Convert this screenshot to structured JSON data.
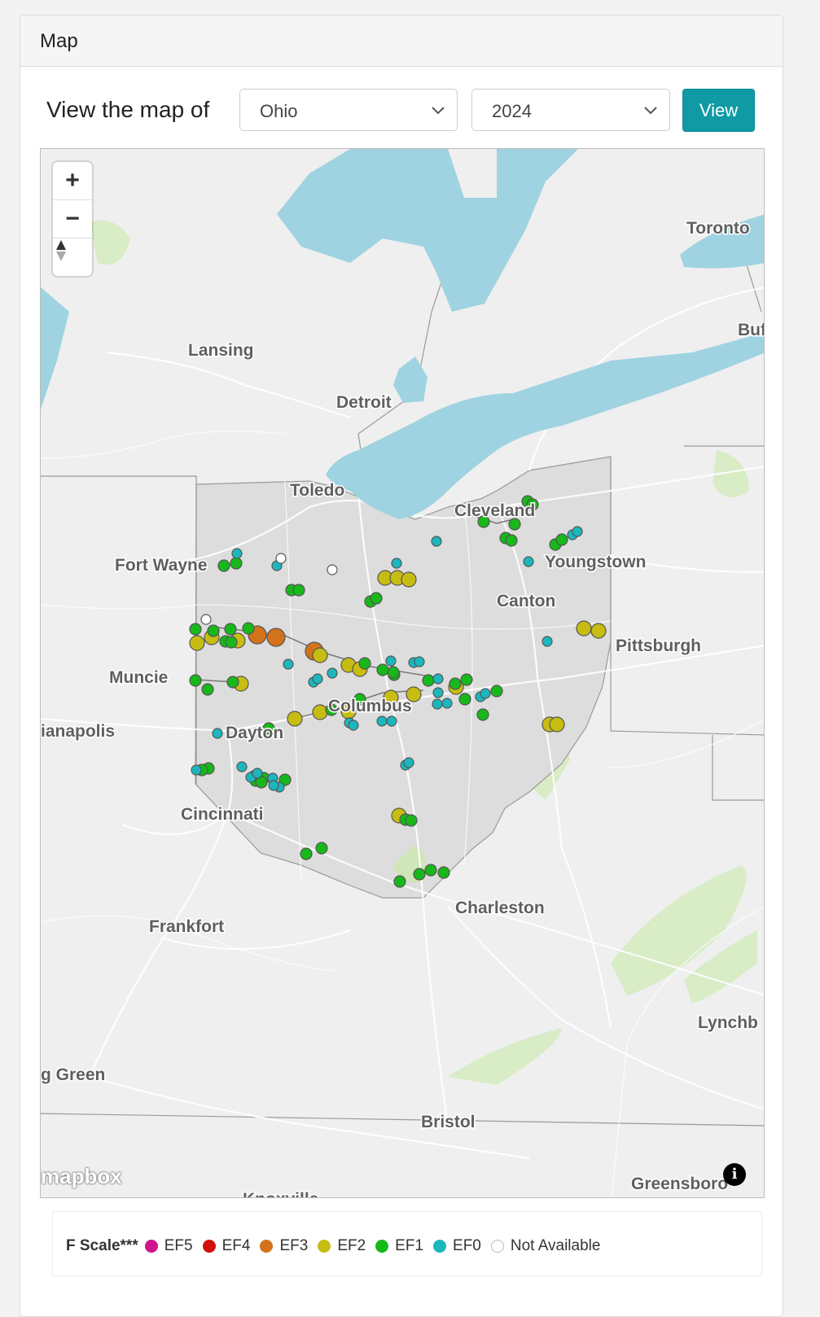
{
  "panel": {
    "title": "Map"
  },
  "controls": {
    "label": "View the map of",
    "state_value": "Ohio",
    "year_value": "2024",
    "view_label": "View"
  },
  "map": {
    "colors": {
      "water": "#9fd3e1",
      "land": "#efefef",
      "highlight": "#dddddd",
      "park": "#d6edc4"
    },
    "cities": [
      {
        "name": "Toronto"
      },
      {
        "name": "Buf"
      },
      {
        "name": "Lansing"
      },
      {
        "name": "Detroit"
      },
      {
        "name": "Toledo"
      },
      {
        "name": "Cleveland"
      },
      {
        "name": "Fort Wayne"
      },
      {
        "name": "Youngstown"
      },
      {
        "name": "Canton"
      },
      {
        "name": "Pittsburgh"
      },
      {
        "name": "Muncie"
      },
      {
        "name": "Columbus"
      },
      {
        "name": "ianapolis"
      },
      {
        "name": "Dayton"
      },
      {
        "name": "Cincinnati"
      },
      {
        "name": "Charleston"
      },
      {
        "name": "Frankfort"
      },
      {
        "name": "Lynchb"
      },
      {
        "name": "g Green"
      },
      {
        "name": "Bristol"
      },
      {
        "name": "Greensboro"
      },
      {
        "name": "Knoxville"
      }
    ],
    "zoom_in_label": "+",
    "zoom_out_label": "−",
    "compass_icon": "compass-icon",
    "attribution_logo": "mapbox",
    "info_label": "i"
  },
  "legend": {
    "label": "F Scale***",
    "items": [
      {
        "label": "EF5",
        "color": "#d0138f"
      },
      {
        "label": "EF4",
        "color": "#d20f0f"
      },
      {
        "label": "EF3",
        "color": "#d2731c"
      },
      {
        "label": "EF2",
        "color": "#c7bd12"
      },
      {
        "label": "EF1",
        "color": "#17b81a"
      },
      {
        "label": "EF0",
        "color": "#1bb7bd"
      },
      {
        "label": "Not Available",
        "color": "#ffffff"
      }
    ]
  }
}
